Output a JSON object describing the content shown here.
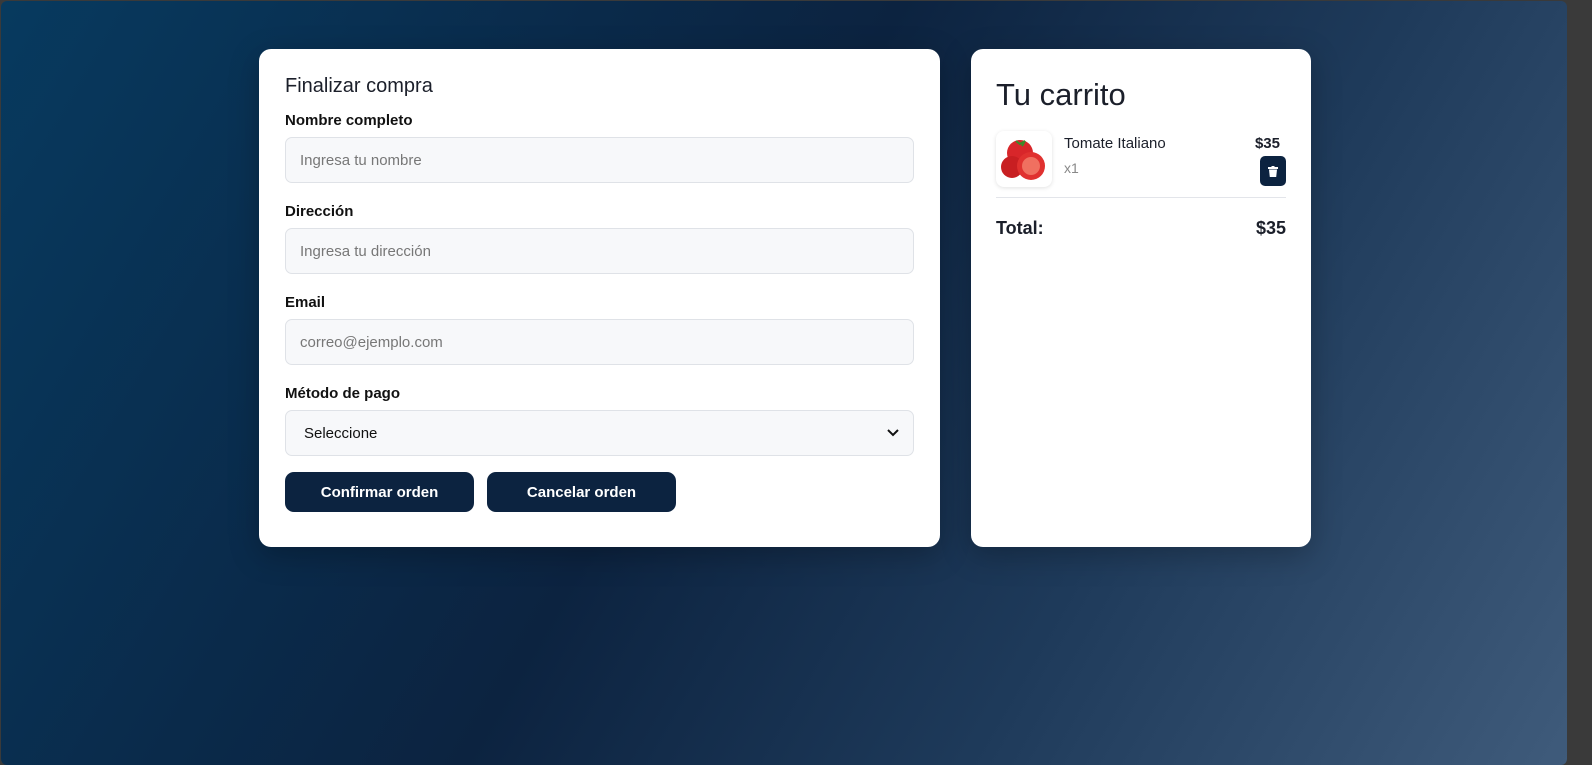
{
  "checkout": {
    "title": "Finalizar compra",
    "fields": [
      {
        "label": "Nombre completo",
        "placeholder": "Ingresa tu nombre"
      },
      {
        "label": "Dirección",
        "placeholder": "Ingresa tu dirección"
      },
      {
        "label": "Email",
        "placeholder": "correo@ejemplo.com"
      }
    ],
    "payment": {
      "label": "Método de pago",
      "selected": "Seleccione"
    },
    "confirm_label": "Confirmar orden",
    "cancel_label": "Cancelar orden"
  },
  "cart": {
    "title": "Tu carrito",
    "items": [
      {
        "name": "Tomate Italiano",
        "qty": "x1",
        "price": "$35",
        "icon": "trash-icon"
      }
    ],
    "total_label": "Total:",
    "total_value": "$35"
  },
  "colors": {
    "primary": "#0c2340"
  }
}
